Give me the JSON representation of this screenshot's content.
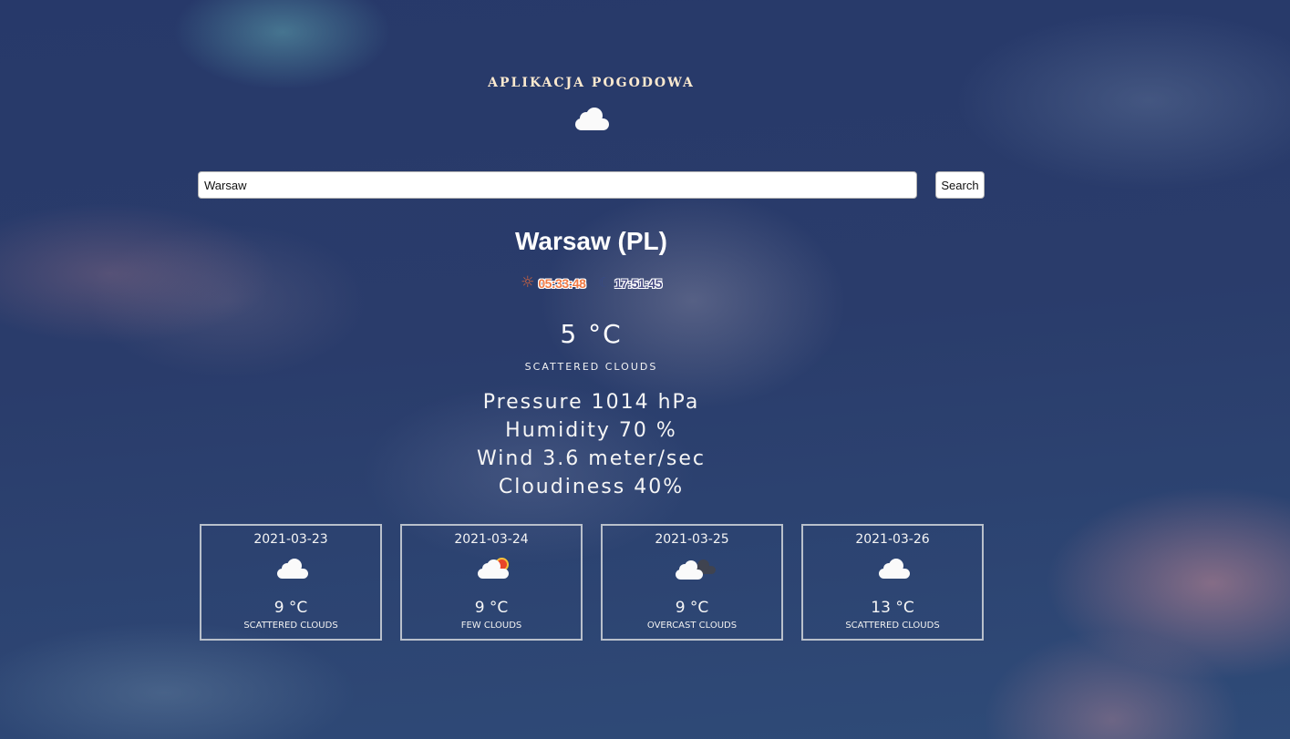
{
  "app": {
    "title": "APLIKACJA POGODOWA",
    "logo_icon": "cloud-icon"
  },
  "search": {
    "value": "Warsaw",
    "button_label": "Search"
  },
  "city": {
    "name": "Warsaw (PL)",
    "sunrise": "05:33:48",
    "sunset": "17:51:45",
    "sunrise_icon": "sun-icon",
    "sunset_icon": "moon-icon"
  },
  "current": {
    "temperature": "5 °C",
    "description": "SCATTERED CLOUDS",
    "pressure": "Pressure 1014 hPa",
    "humidity": "Humidity 70 %",
    "wind": "Wind 3.6 meter/sec",
    "cloudiness": "Cloudiness 40%"
  },
  "forecast": [
    {
      "date": "2021-03-23",
      "temp": "9 °C",
      "desc": "SCATTERED CLOUDS",
      "icon": "cloud-icon"
    },
    {
      "date": "2021-03-24",
      "temp": "9 °C",
      "desc": "FEW CLOUDS",
      "icon": "sun-behind-cloud-icon"
    },
    {
      "date": "2021-03-25",
      "temp": "9 °C",
      "desc": "OVERCAST CLOUDS",
      "icon": "overcast-clouds-icon"
    },
    {
      "date": "2021-03-26",
      "temp": "13 °C",
      "desc": "SCATTERED CLOUDS",
      "icon": "cloud-icon"
    }
  ],
  "colors": {
    "title": "#fbe9cf",
    "sunrise": "#f07a45",
    "sunset": "#4a4f86",
    "card_border": "#b9c0cb"
  }
}
